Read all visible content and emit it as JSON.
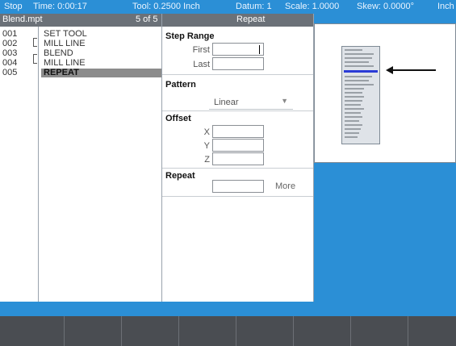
{
  "status_bar": {
    "mode": "Stop",
    "time": "Time: 0:00:17",
    "tool": "Tool: 0.2500 Inch",
    "datum": "Datum: 1",
    "scale": "Scale: 1.0000",
    "skew": "Skew: 0.0000°",
    "units": "Inch"
  },
  "program": {
    "filename": "Blend.mpt",
    "position": "5 of 5",
    "rows": [
      {
        "num": "001",
        "text": "SET TOOL"
      },
      {
        "num": "002",
        "text": "MILL LINE"
      },
      {
        "num": "003",
        "text": "BLEND"
      },
      {
        "num": "004",
        "text": "MILL LINE"
      },
      {
        "num": "005",
        "text": "REPEAT"
      }
    ],
    "selected_index": 4
  },
  "form": {
    "title": "Repeat",
    "step_range": {
      "title": "Step Range",
      "first_label": "First",
      "last_label": "Last",
      "first_value": "",
      "last_value": ""
    },
    "pattern": {
      "title": "Pattern",
      "value": "Linear"
    },
    "offset": {
      "title": "Offset",
      "x_label": "X",
      "y_label": "Y",
      "z_label": "Z",
      "x": "",
      "y": "",
      "z": ""
    },
    "repeat": {
      "title": "Repeat",
      "value": "",
      "more_label": "More"
    }
  },
  "softkeys": [
    "",
    "",
    "",
    "",
    "",
    "",
    "",
    ""
  ],
  "colors": {
    "accent": "#2b8fd6",
    "header": "#6b7178",
    "selected_row": "#8c8c8c",
    "softkey": "#4a4d52"
  }
}
